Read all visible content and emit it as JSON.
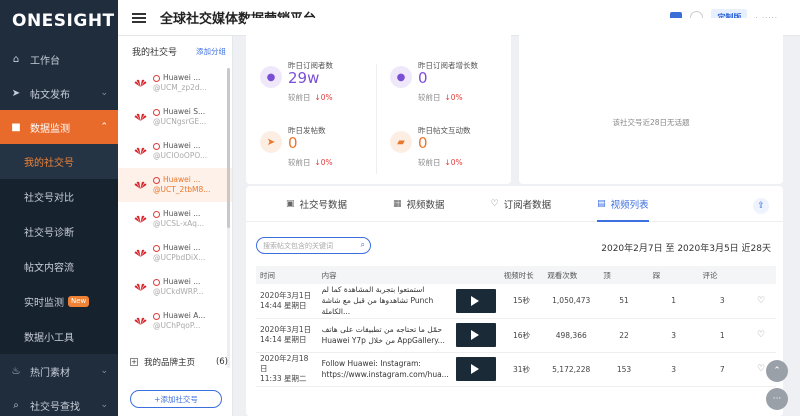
{
  "sidebar": {
    "logo": "ONESIGHT",
    "items": [
      {
        "label": "工作台",
        "icon": "home-icon"
      },
      {
        "label": "帖文发布",
        "icon": "send-icon"
      },
      {
        "label": "数据监测",
        "icon": "briefcase-icon"
      },
      {
        "label": "热门素材",
        "icon": "fire-icon"
      },
      {
        "label": "社交号查找",
        "icon": "search-icon"
      }
    ],
    "subitems": [
      {
        "label": "我的社交号"
      },
      {
        "label": "社交号对比"
      },
      {
        "label": "社交号诊断"
      },
      {
        "label": "帖文内容流"
      },
      {
        "label": "实时监测",
        "badge": "New"
      },
      {
        "label": "数据小工具"
      }
    ]
  },
  "header": {
    "title": "全球社交媒体数据营销平台",
    "custom_label": "定制版",
    "user": "· ·····"
  },
  "accounts": {
    "heading": "我的社交号",
    "add_group": "添加分组",
    "items": [
      {
        "name": "Huawei ...",
        "id": "UCM_zp2d..."
      },
      {
        "name": "Huawei S...",
        "id": "UCNgsrGE..."
      },
      {
        "name": "Huawei ...",
        "id": "UCIOoOPO..."
      },
      {
        "name": "Huawei ...",
        "id": "UCT_2tbM8..."
      },
      {
        "name": "Huawei ...",
        "id": "UCSL-xAq..."
      },
      {
        "name": "Huawei ...",
        "id": "UCPbdDiX..."
      },
      {
        "name": "Huawei ...",
        "id": "UCkdWRP..."
      },
      {
        "name": "Huawei A...",
        "id": "UChPqoP..."
      }
    ],
    "brand_label": "我的品牌主页",
    "brand_count": "(6)",
    "add_button": "+添加社交号"
  },
  "stats": {
    "items": [
      {
        "label": "昨日订阅者数",
        "value": "29w",
        "cmp": "较前日",
        "delta": "↓0%",
        "icon": "user-icon",
        "color": "#7a4fd6",
        "bg": "#efe8fb"
      },
      {
        "label": "昨日订阅者增长数",
        "value": "0",
        "cmp": "较前日",
        "delta": "↓0%",
        "icon": "user-plus-icon",
        "color": "#7a4fd6",
        "bg": "#efe8fb"
      },
      {
        "label": "昨日发帖数",
        "value": "0",
        "cmp": "较前日",
        "delta": "↓0%",
        "icon": "paper-plane-icon",
        "color": "#e9772e",
        "bg": "#fdeee4"
      },
      {
        "label": "昨日帖文互动数",
        "value": "0",
        "cmp": "较前日",
        "delta": "↓0%",
        "icon": "chat-icon",
        "color": "#e9772e",
        "bg": "#fdeee4"
      }
    ],
    "empty_text": "该社交号近28日无话题"
  },
  "data_panel": {
    "tabs": [
      {
        "label": "社交号数据",
        "icon": "image-icon"
      },
      {
        "label": "视频数据",
        "icon": "grid-icon"
      },
      {
        "label": "订阅者数据",
        "icon": "heart-icon"
      },
      {
        "label": "视频列表",
        "icon": "doc-icon"
      }
    ],
    "search_placeholder": "搜索帖文包含的关键词",
    "date_range": "2020年2月7日 至 2020年3月5日 近28天",
    "columns": [
      "时间",
      "内容",
      "视频时长",
      "观看次数",
      "顶",
      "踩",
      "评论",
      ""
    ],
    "rows": [
      {
        "date": "2020年3月1日",
        "time": "14:44 星期日",
        "content": "استمتعوا بتجربة المشاهدة كما لم تشاهدوها من قبل مع شاشة Punch الكاملة...",
        "duration": "15秒",
        "views": "1,050,473",
        "likes": "51",
        "dislikes": "1",
        "comments": "3"
      },
      {
        "date": "2020年3月1日",
        "time": "14:14 星期日",
        "content": "حمّل ما تحتاجه من تطبيقات على هاتف Huawei Y7p من خلال AppGallery...",
        "duration": "16秒",
        "views": "498,366",
        "likes": "22",
        "dislikes": "3",
        "comments": "1"
      },
      {
        "date": "2020年2月18日",
        "time": "11:33 星期二",
        "content": "Follow Huawei: Instagram: https://www.instagram.com/hua...",
        "duration": "31秒",
        "views": "5,172,228",
        "likes": "153",
        "dislikes": "3",
        "comments": "7"
      }
    ]
  }
}
